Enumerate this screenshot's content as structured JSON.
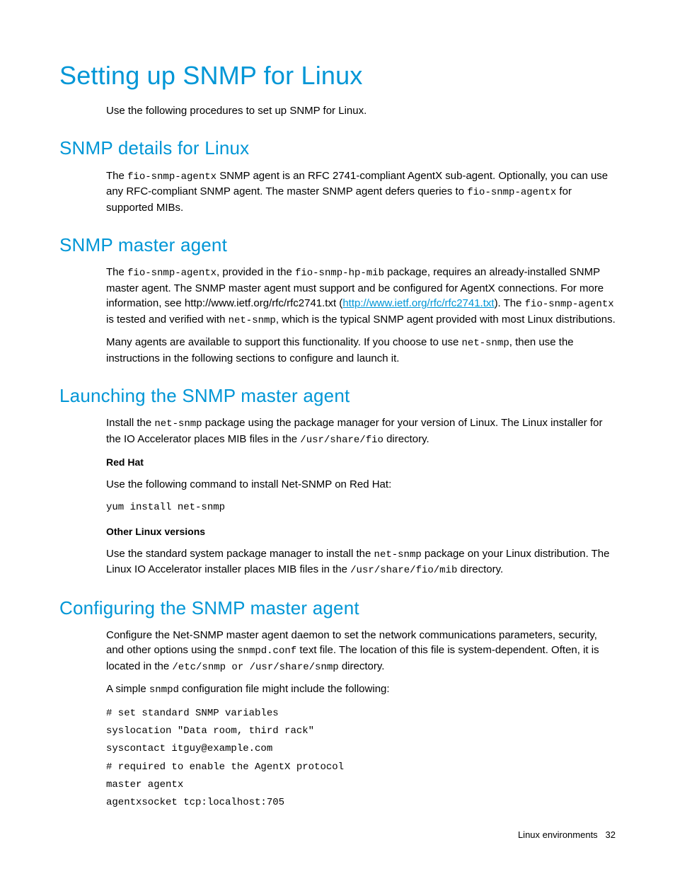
{
  "h1": "Setting up SNMP for Linux",
  "intro": "Use the following procedures to set up SNMP for Linux.",
  "s1": {
    "h": "SNMP details for Linux",
    "p1a": "The ",
    "c1": "fio-snmp-agentx",
    "p1b": " SNMP agent is an RFC 2741-compliant AgentX sub-agent. Optionally, you can use any RFC-compliant SNMP agent. The master SNMP agent defers queries to ",
    "c2": "fio-snmp-agentx",
    "p1c": " for supported MIBs."
  },
  "s2": {
    "h": "SNMP master agent",
    "p1a": "The ",
    "c1": "fio-snmp-agentx",
    "p1b": ", provided in the ",
    "c2": "fio-snmp-hp-mib",
    "p1c": " package, requires an already-installed SNMP master agent. The SNMP master agent must support and be configured for AgentX connections. For more information, see http://www.ietf.org/rfc/rfc2741.txt (",
    "link": "http://www.ietf.org/rfc/rfc2741.txt",
    "p1d": "). The ",
    "c3": "fio-snmp-agentx",
    "p1e": " is tested and verified with ",
    "c4": "net-snmp",
    "p1f": ", which is the typical SNMP agent provided with most Linux distributions.",
    "p2a": "Many agents are available to support this functionality. If you choose to use ",
    "c5": "net-snmp",
    "p2b": ", then use the instructions in the following sections to configure and launch it."
  },
  "s3": {
    "h": "Launching the SNMP master agent",
    "p1a": "Install the ",
    "c1": "net-snmp",
    "p1b": " package using the package manager for your version of Linux. The Linux installer for the IO Accelerator places MIB files in the ",
    "c2": "/usr/share/fio",
    "p1c": " directory.",
    "sub1": "Red Hat",
    "p2": "Use the following command to install Net-SNMP on Red Hat:",
    "code1": "yum install net-snmp",
    "sub2": "Other Linux versions",
    "p3a": "Use the standard system package manager to install the ",
    "c3": "net-snmp",
    "p3b": " package on your Linux distribution. The Linux IO Accelerator installer places MIB files in the ",
    "c4": "/usr/share/fio/mib",
    "p3c": " directory."
  },
  "s4": {
    "h": "Configuring the SNMP master agent",
    "p1a": "Configure the Net-SNMP master agent daemon to set the network communications parameters, security, and other options using the ",
    "c1": "snmpd.conf",
    "p1b": " text file. The location of this file is system-dependent. Often, it is located in the ",
    "c2": "/etc/snmp or /usr/share/snmp",
    "p1c": " directory.",
    "p2a": "A simple ",
    "c3": "snmpd",
    "p2b": " configuration file might include the following:",
    "code": "# set standard SNMP variables\nsyslocation \"Data room, third rack\"\nsyscontact itguy@example.com\n# required to enable the AgentX protocol\nmaster agentx\nagentxsocket tcp:localhost:705"
  },
  "footer": {
    "section": "Linux environments",
    "page": "32"
  }
}
